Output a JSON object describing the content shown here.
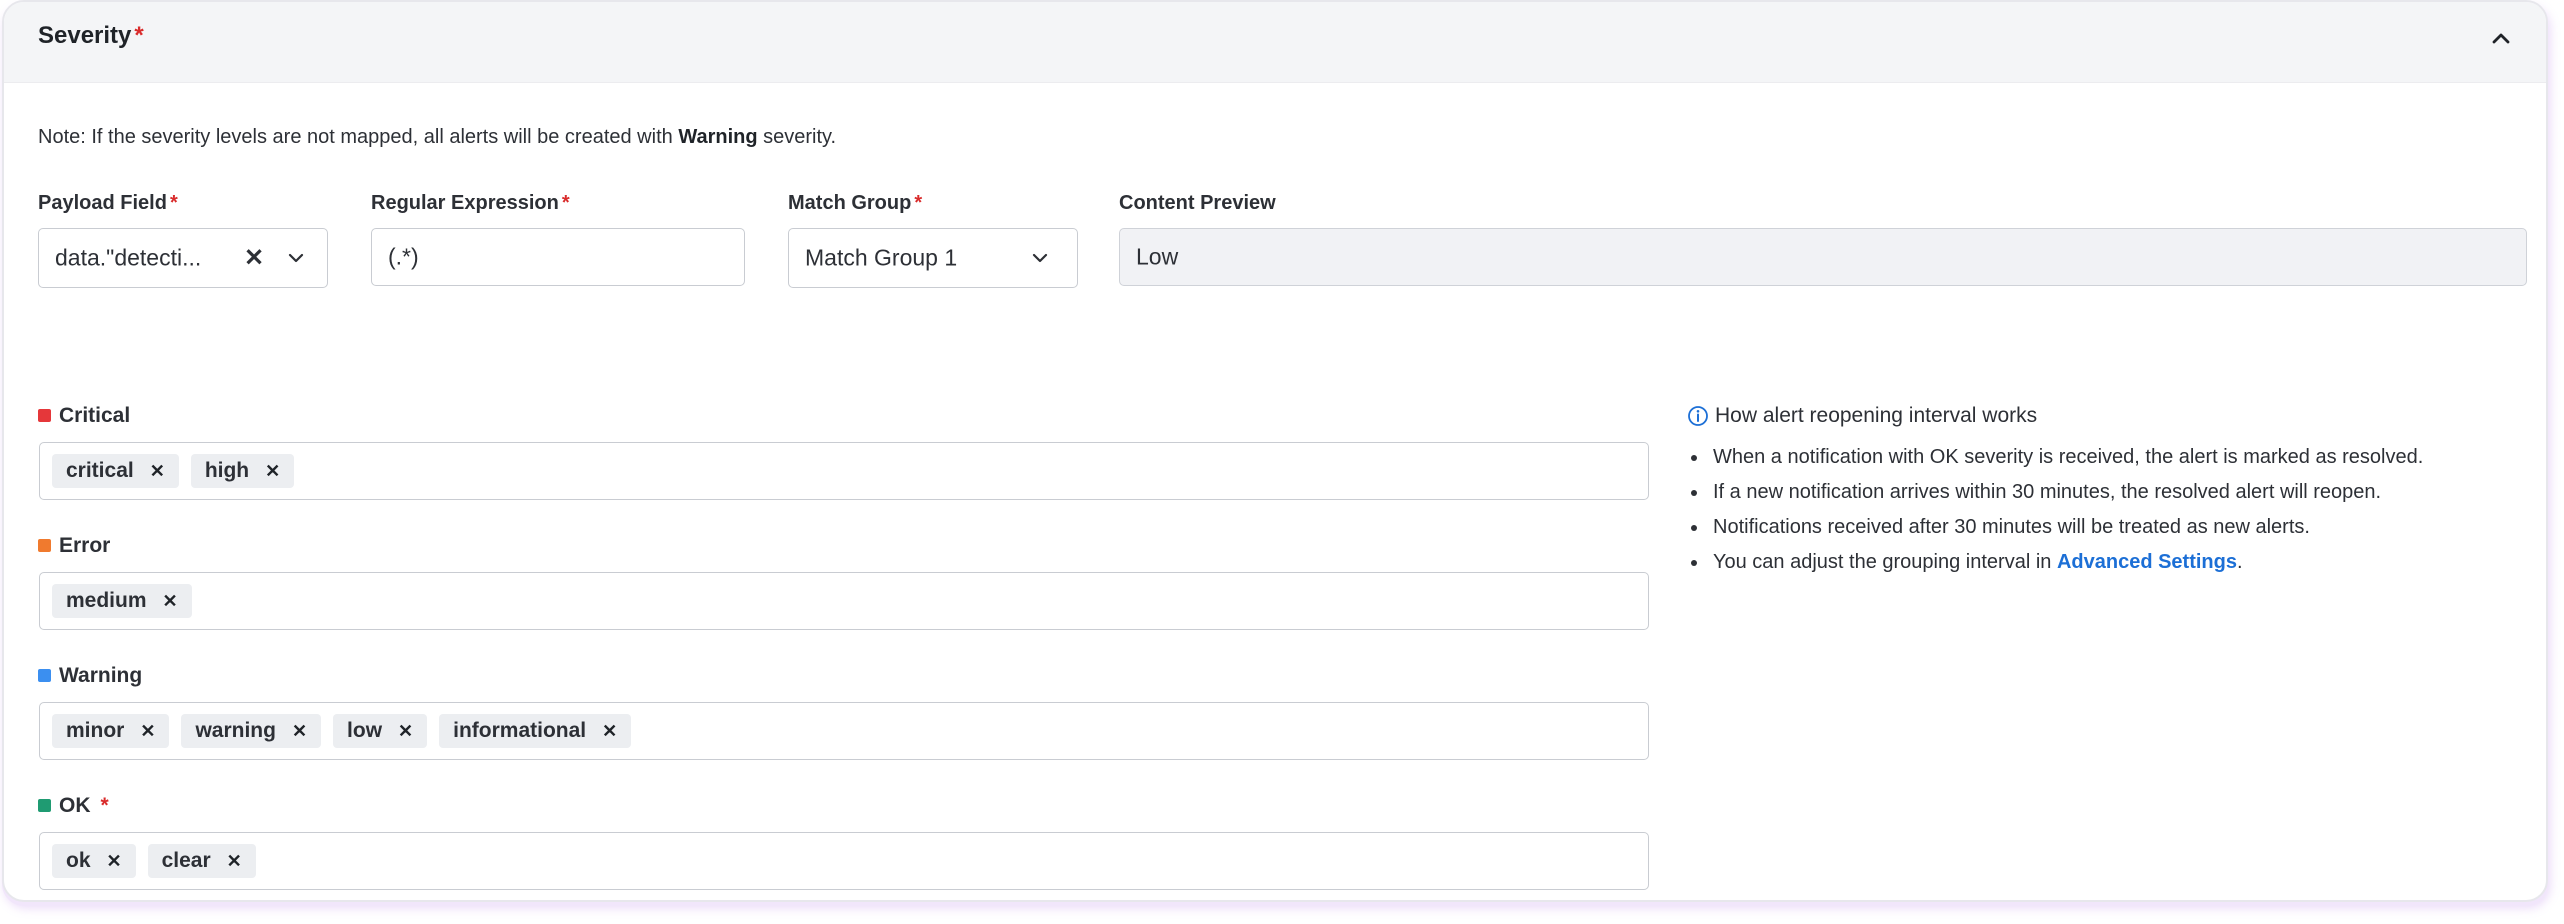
{
  "header": {
    "title": "Severity",
    "required_mark": "*"
  },
  "note": {
    "prefix": "Note: If the severity levels are not mapped, all alerts will be created with ",
    "bold": "Warning",
    "suffix": " severity."
  },
  "fields": {
    "payload": {
      "label": "Payload Field",
      "value": "data.\"detecti...",
      "required_mark": "*"
    },
    "regex": {
      "label": "Regular Expression",
      "value": "(.*)",
      "required_mark": "*"
    },
    "match_group": {
      "label": "Match Group",
      "value": "Match Group 1",
      "required_mark": "*"
    },
    "preview": {
      "label": "Content Preview",
      "value": "Low"
    }
  },
  "severities": [
    {
      "label": "Critical",
      "color": "#e5373a",
      "tags": [
        "critical",
        "high"
      ]
    },
    {
      "label": "Error",
      "color": "#f07a2e",
      "tags": [
        "medium"
      ]
    },
    {
      "label": "Warning",
      "color": "#3b8ff0",
      "tags": [
        "minor",
        "warning",
        "low",
        "informational"
      ]
    },
    {
      "label": "OK",
      "color": "#1f9b72",
      "required_mark": "*",
      "tags": [
        "ok",
        "clear"
      ]
    }
  ],
  "info": {
    "title": "How alert reopening interval works",
    "items": [
      "When a notification with OK severity is received, the alert is marked as resolved.",
      "If a new notification arrives within 30 minutes, the resolved alert will reopen.",
      "Notifications received after 30 minutes will be treated as new alerts."
    ],
    "last_item_prefix": "You can adjust the grouping interval in ",
    "last_item_link": "Advanced Settings",
    "last_item_suffix": "."
  },
  "icons": {
    "collapse": "chevron-up-icon",
    "clear": "close-icon",
    "dropdown": "chevron-down-icon",
    "info": "info-circle-icon"
  }
}
